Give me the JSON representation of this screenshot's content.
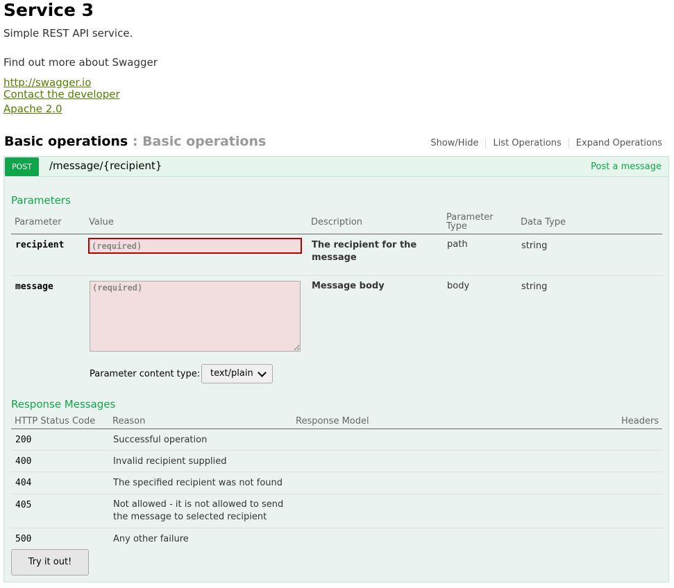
{
  "info": {
    "title": "Service 3",
    "description": "Simple REST API service.",
    "find_more": "Find out more about Swagger",
    "links": [
      "http://swagger.io",
      "Contact the developer",
      "Apache 2.0"
    ]
  },
  "resource": {
    "name": "Basic operations",
    "separator": ":",
    "description": "Basic operations",
    "actions": [
      "Show/Hide",
      "List Operations",
      "Expand Operations"
    ]
  },
  "operation": {
    "method": "POST",
    "path": "/message/{recipient}",
    "summary": "Post a message"
  },
  "parameters": {
    "title": "Parameters",
    "headers": {
      "parameter": "Parameter",
      "value": "Value",
      "description": "Description",
      "param_type_line1": "Parameter",
      "param_type_line2": "Type",
      "data_type": "Data Type"
    },
    "rows": [
      {
        "name": "recipient",
        "placeholder": "(required)",
        "description": "The recipient for the message",
        "param_type": "path",
        "data_type": "string"
      },
      {
        "name": "message",
        "placeholder": "(required)",
        "description": "Message body",
        "param_type": "body",
        "data_type": "string"
      }
    ],
    "content_type_label": "Parameter content type:",
    "content_type_value": "text/plain"
  },
  "responses": {
    "title": "Response Messages",
    "headers": {
      "code": "HTTP Status Code",
      "reason": "Reason",
      "model": "Response Model",
      "headers": "Headers"
    },
    "rows": [
      {
        "code": "200",
        "reason": "Successful operation"
      },
      {
        "code": "400",
        "reason": "Invalid recipient supplied"
      },
      {
        "code": "404",
        "reason": "The specified recipient was not found"
      },
      {
        "code": "405",
        "reason_line1": "Not allowed - it is not allowed to send",
        "reason_line2": "the message to selected recipient"
      },
      {
        "code": "500",
        "reason": "Any other failure"
      }
    ]
  },
  "try_button": "Try it out!"
}
